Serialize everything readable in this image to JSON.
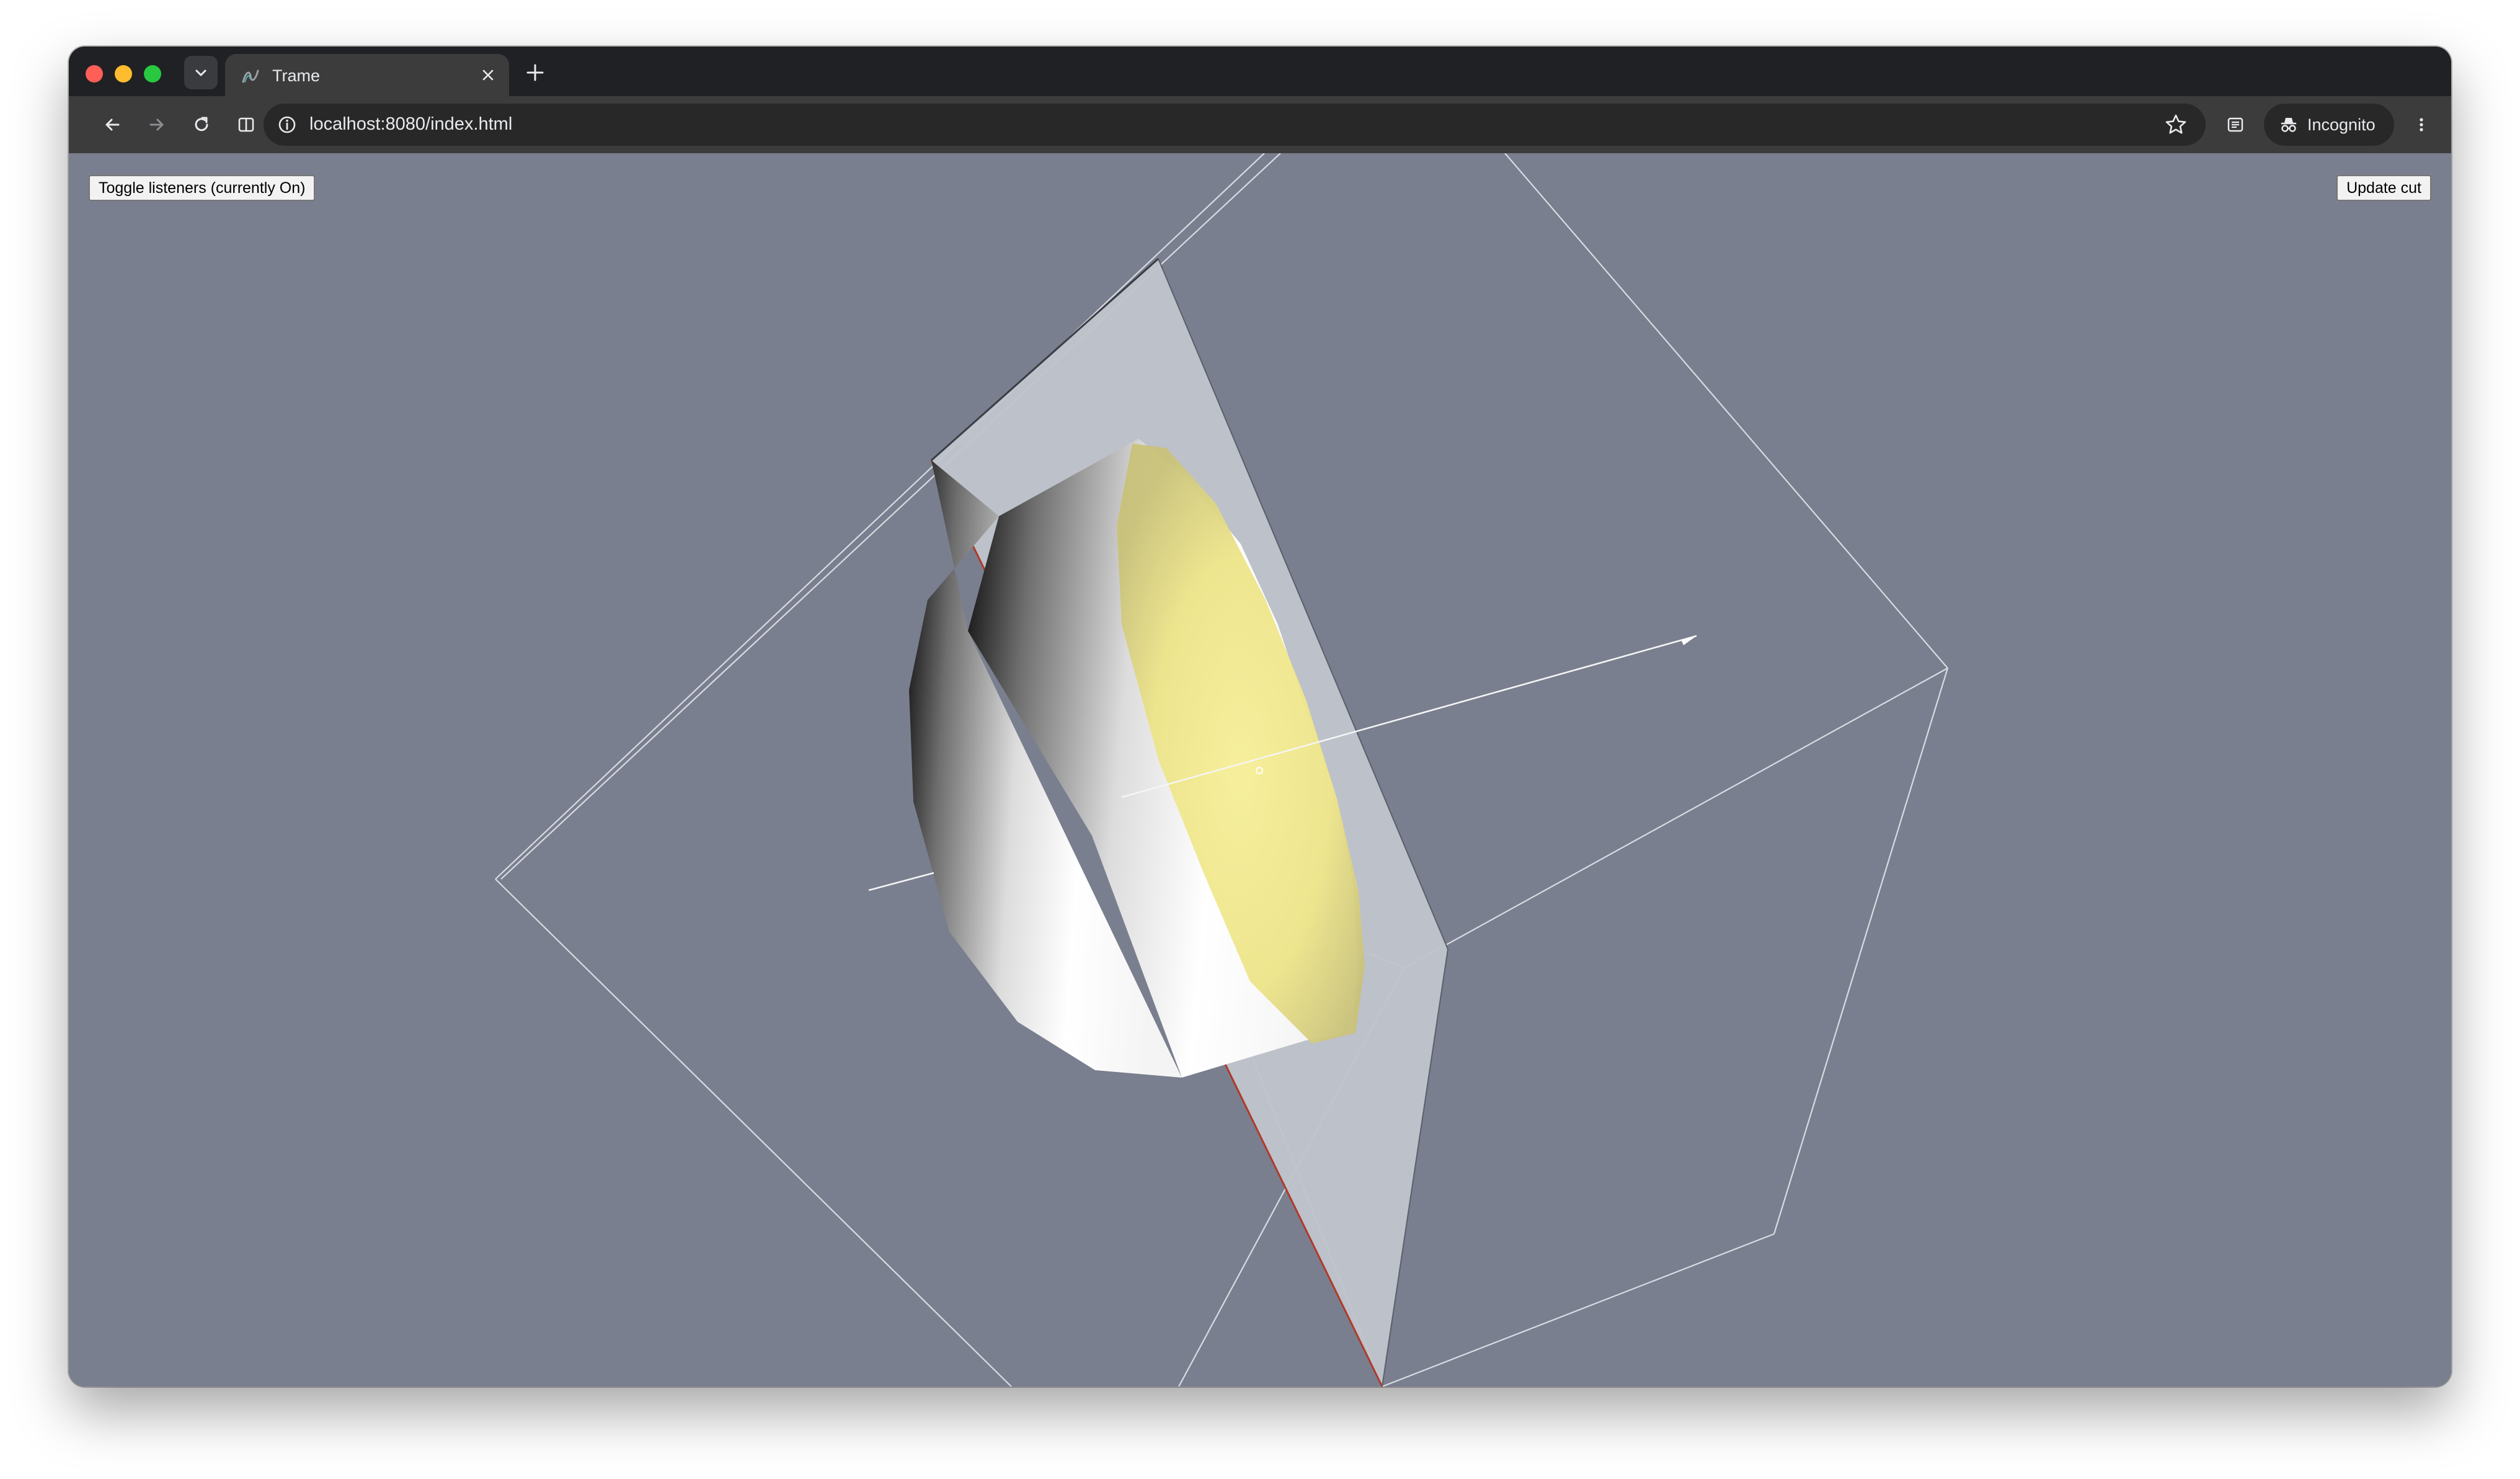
{
  "browser": {
    "tab": {
      "title": "Trame"
    },
    "address": {
      "url": "localhost:8080/index.html"
    },
    "profile": {
      "label": "Incognito"
    }
  },
  "app": {
    "toggle_button_label": "Toggle listeners (currently On)",
    "update_button_label": "Update cut"
  },
  "icons": {
    "tab_search": "chevron-down-icon",
    "favicon": "trame-icon",
    "close_tab": "close-icon",
    "new_tab": "plus-icon",
    "back": "arrow-left-icon",
    "forward": "arrow-right-icon",
    "reload": "reload-icon",
    "split": "split-view-icon",
    "site_info": "info-icon",
    "bookmark": "star-icon",
    "reading_list": "reading-list-icon",
    "devices": "devices-icon",
    "incognito": "incognito-icon",
    "menu": "kebab-menu-icon"
  },
  "colors": {
    "viewport_background": "#7a7f8f",
    "plane_fill": "#c0c4cb",
    "plane_edge": "#b03a2a",
    "cut_fill": "#f2e98c",
    "outline": "#d9dbe2"
  }
}
